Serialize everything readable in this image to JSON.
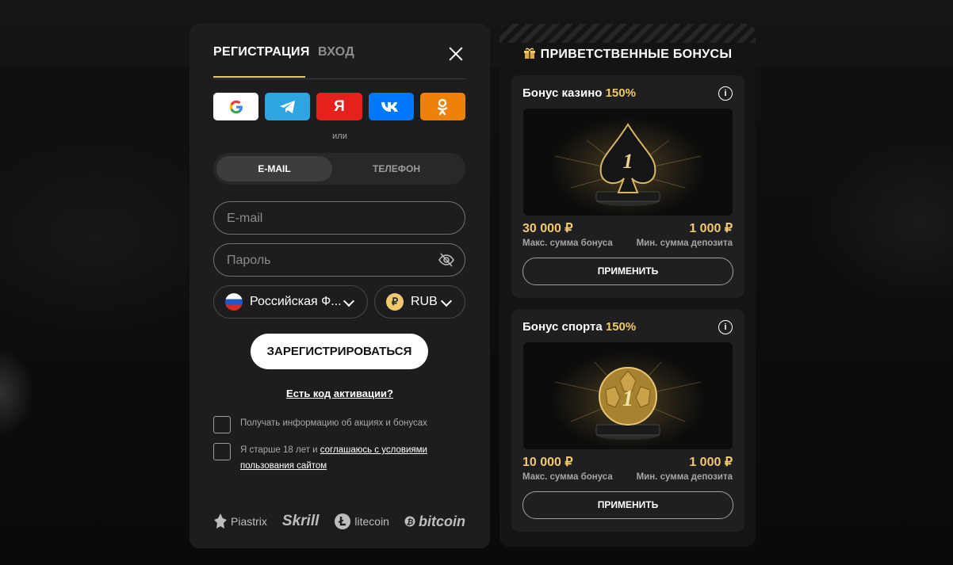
{
  "registration": {
    "tabs": [
      "РЕГИСТРАЦИЯ",
      "ВХОД"
    ],
    "social_icons": [
      "google-icon",
      "telegram-icon",
      "yandex-icon",
      "vk-icon",
      "odnoklassniki-icon"
    ],
    "yandex_glyph": "Я",
    "or_text": "или",
    "method_tabs": [
      "E-MAIL",
      "ТЕЛЕФОН"
    ],
    "email_placeholder": "E-mail",
    "password_placeholder": "Пароль",
    "country_label": "Российская Ф...",
    "currency_label": "RUB",
    "currency_symbol": "₽",
    "register_button": "ЗАРЕГИСТРИРОВАТЬСЯ",
    "activation_link": "Есть код активации?",
    "checkbox1_text": "Получать информацию об акциях и бонусах",
    "checkbox2_prefix": "Я старше 18 лет и ",
    "checkbox2_link": "соглашаюсь с условиями пользования сайтом",
    "payments": [
      "Piastrix",
      "Skrill",
      "litecoin",
      "bitcoin"
    ]
  },
  "bonuses": {
    "title": "ПРИВЕТСТВЕННЫЕ БОНУСЫ",
    "cards": [
      {
        "title": "Бонус казино ",
        "percent": "150%",
        "max_value": "30 000 ₽",
        "min_value": "1 000 ₽",
        "max_label": "Макс. сумма бонуса",
        "min_label": "Мин. сумма депозита",
        "button": "ПРИМЕНИТЬ",
        "trophy_number": "1"
      },
      {
        "title": "Бонус спорта ",
        "percent": "150%",
        "max_value": "10 000 ₽",
        "min_value": "1 000 ₽",
        "max_label": "Макс. сумма бонуса",
        "min_label": "Мин. сумма депозита",
        "button": "ПРИМЕНИТЬ",
        "trophy_number": "1"
      }
    ]
  },
  "colors": {
    "accent_gold": "#f0c870",
    "panel": "#1d1d1f",
    "google": "#ffffff",
    "telegram": "#2da5e1",
    "yandex": "#e5211d",
    "vk": "#0077ff",
    "ok": "#ee8208"
  }
}
